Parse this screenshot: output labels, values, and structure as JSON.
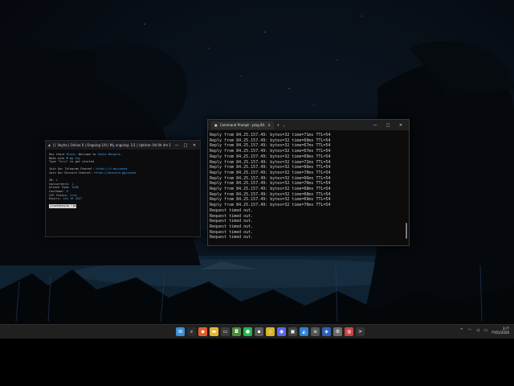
{
  "left_window": {
    "title": "[{ Veyha | Online 0 | Ongoing 1/9 | My ongoing: 1/1 | Uptime: 0d 0h 4m 14s }]",
    "lines": [
      {
        "a": "Hey there ",
        "b": "Brock",
        "c": ", Welcome to ",
        "d": "Veyha Network."
      },
      {
        "a": "Made with ",
        "b": "♥",
        "c": " by ",
        "d": "Vey"
      },
      {
        "a": "Type \"",
        "b": "help",
        "c": "\" to get started",
        "d": ""
      },
      {
        "a": "",
        "b": "",
        "c": "",
        "d": ""
      },
      {
        "a": "Join Our Telegram Channel: ",
        "b": "https://t.me/veyha",
        "c": "",
        "d": ""
      },
      {
        "a": "Join Our Discord Channel: ",
        "b": "https://discord.gg/veyha",
        "c": "",
        "d": ""
      },
      {
        "a": "",
        "b": "",
        "c": "",
        "d": ""
      },
      {
        "a": "ID: ",
        "b": "1",
        "c": "",
        "d": ""
      },
      {
        "a": "Concurrents: ",
        "b": "1",
        "c": "",
        "d": ""
      },
      {
        "a": "Attack Time: ",
        "b": "1200",
        "c": "",
        "d": ""
      },
      {
        "a": "Cooldown: ",
        "b": "0",
        "c": "",
        "d": ""
      },
      {
        "a": "VIP Status: ",
        "b": "true",
        "c": "",
        "d": ""
      },
      {
        "a": "Expiry: ",
        "b": "Jan 10 2027",
        "c": "",
        "d": ""
      }
    ],
    "prompt": "[root@veyha ~]#"
  },
  "right_window": {
    "tab_title": "Command Prompt - ping 84.",
    "lines": [
      "Reply from 84.25.157.49: bytes=32 time=71ms TTL=54",
      "Reply from 84.25.157.49: bytes=32 time=69ms TTL=54",
      "Reply from 84.25.157.49: bytes=32 time=67ms TTL=54",
      "Reply from 84.25.157.49: bytes=32 time=67ms TTL=54",
      "Reply from 84.25.157.49: bytes=32 time=69ms TTL=54",
      "Reply from 84.25.157.49: bytes=32 time=72ms TTL=54",
      "Reply from 84.25.157.49: bytes=32 time=66ms TTL=54",
      "Reply from 84.25.157.49: bytes=32 time=70ms TTL=54",
      "Reply from 84.25.157.49: bytes=32 time=66ms TTL=54",
      "Reply from 84.25.157.49: bytes=32 time=70ms TTL=54",
      "Reply from 84.25.157.49: bytes=32 time=68ms TTL=54",
      "Reply from 84.25.157.49: bytes=32 time=68ms TTL=54",
      "Reply from 84.25.157.49: bytes=32 time=69ms TTL=54",
      "Reply from 84.25.157.49: bytes=32 time=70ms TTL=54",
      "Request timed out.",
      "Request timed out.",
      "Request timed out.",
      "Request timed out.",
      "Request timed out.",
      "Request timed out."
    ]
  },
  "taskbar": {
    "apps": [
      {
        "name": "start-icon",
        "color": "#3b8fd9",
        "glyph": "⊞"
      },
      {
        "name": "search-icon",
        "color": "#2b2b2b",
        "glyph": "⌕"
      },
      {
        "name": "brave-icon",
        "color": "#e25c2c",
        "glyph": "◆"
      },
      {
        "name": "folder-icon",
        "color": "#e8b533",
        "glyph": "▬"
      },
      {
        "name": "terminal-icon",
        "color": "#3a3a3a",
        "glyph": "▭"
      },
      {
        "name": "shield-icon",
        "color": "#4a8a3a",
        "glyph": "◘"
      },
      {
        "name": "spotify-icon",
        "color": "#1db954",
        "glyph": "●"
      },
      {
        "name": "app-icon",
        "color": "#5a5a5a",
        "glyph": "▪"
      },
      {
        "name": "gem-icon",
        "color": "#d8b32a",
        "glyph": "◇"
      },
      {
        "name": "discord-icon",
        "color": "#5865f2",
        "glyph": "◉"
      },
      {
        "name": "monitor-icon",
        "color": "#444",
        "glyph": "▣"
      },
      {
        "name": "vscode-icon",
        "color": "#2f80d0",
        "glyph": "◭"
      },
      {
        "name": "notes-icon",
        "color": "#555",
        "glyph": "≡"
      },
      {
        "name": "shield-blue-icon",
        "color": "#2d5fb8",
        "glyph": "◈"
      },
      {
        "name": "settings-icon",
        "color": "#6b6b6b",
        "glyph": "⚙"
      },
      {
        "name": "browser-icon",
        "color": "#cc4141",
        "glyph": "◍"
      },
      {
        "name": "cmd-icon",
        "color": "#333",
        "glyph": ">"
      }
    ],
    "time": "3:??",
    "date": "??/01/2026"
  }
}
